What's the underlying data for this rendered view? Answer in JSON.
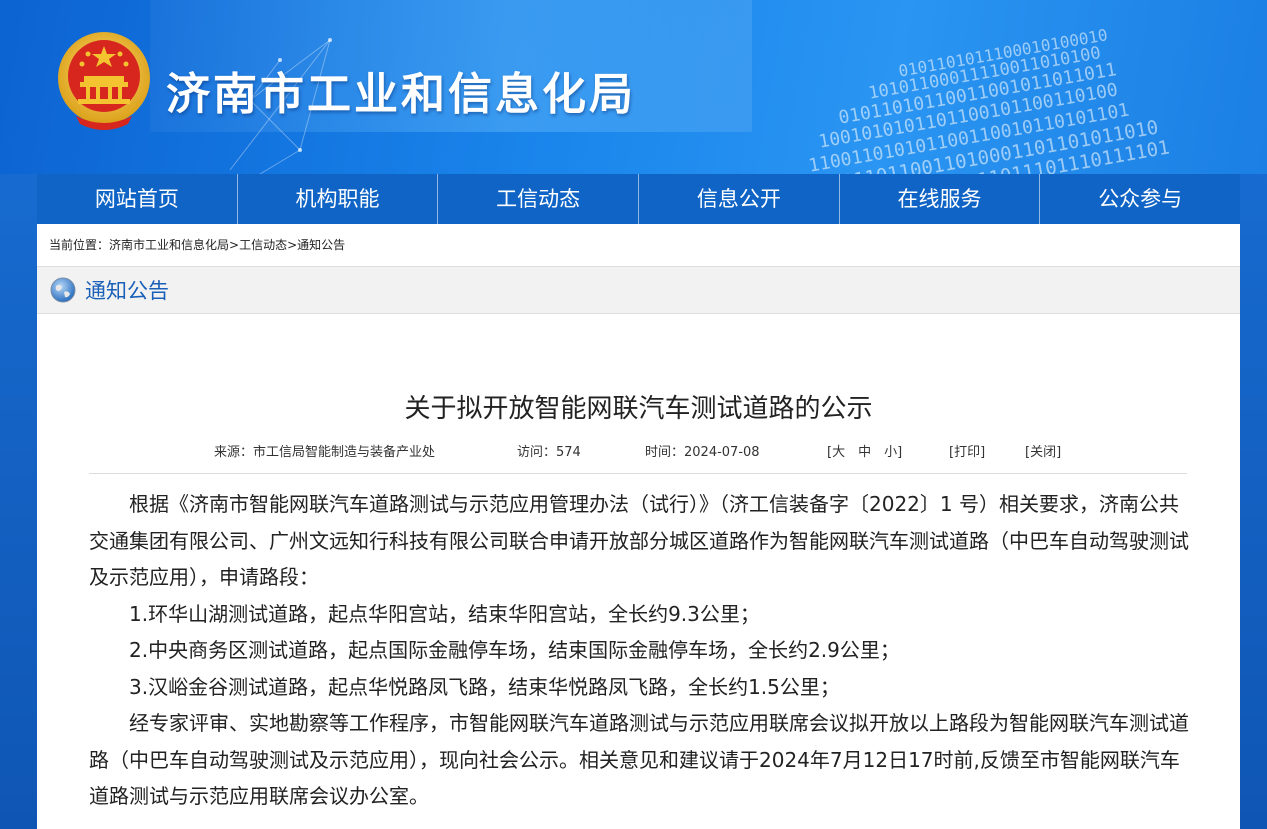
{
  "site": {
    "title": "济南市工业和信息化局",
    "binary_lines": [
      "0101101011100010100010",
      "10101100011110011010100",
      "01011010110011001011011011",
      "1001010101101100101100110100",
      "110011010101100110010110101101",
      "0010110110011010001101101011010",
      "10011000111000111011101110111101"
    ]
  },
  "nav": {
    "items": [
      {
        "label": "网站首页"
      },
      {
        "label": "机构职能"
      },
      {
        "label": "工信动态"
      },
      {
        "label": "信息公开"
      },
      {
        "label": "在线服务"
      },
      {
        "label": "公众参与"
      }
    ]
  },
  "breadcrumb": {
    "prefix": "当前位置：",
    "items": [
      "济南市工业和信息化局",
      "工信动态",
      "通知公告"
    ],
    "separator": ">"
  },
  "section": {
    "title": "通知公告"
  },
  "article": {
    "title": "关于拟开放智能网联汽车测试道路的公示",
    "meta": {
      "source": "来源：市工信局智能制造与装备产业处",
      "visits": "访问：574",
      "date": "时间：2024-07-08",
      "font_size": "[大　中　小]",
      "print": "[打印]",
      "close": "[关闭]"
    },
    "paragraphs": [
      "根据《济南市智能网联汽车道路测试与示范应用管理办法（试行）》（济工信装备字〔2022〕1 号）相关要求，济南公共交通集团有限公司、广州文远知行科技有限公司联合申请开放部分城区道路作为智能网联汽车测试道路（中巴车自动驾驶测试及示范应用），申请路段：",
      "1.环华山湖测试道路，起点华阳宫站，结束华阳宫站，全长约9.3公里；",
      "2.中央商务区测试道路，起点国际金融停车场，结束国际金融停车场，全长约2.9公里；",
      "3.汉峪金谷测试道路，起点华悦路凤飞路，结束华悦路凤飞路，全长约1.5公里；",
      "经专家评审、实地勘察等工作程序，市智能网联汽车道路测试与示范应用联席会议拟开放以上路段为智能网联汽车测试道路（中巴车自动驾驶测试及示范应用），现向社会公示。相关意见和建议请于2024年7月12日17时前,反馈至市智能网联汽车道路测试与示范应用联席会议办公室。"
    ]
  },
  "colors": {
    "nav_bg": "#0f64c6",
    "page_bg": "#1565c8",
    "section_title": "#1a60b8",
    "emblem_red": "#d7261e",
    "emblem_gold": "#f4c430"
  }
}
